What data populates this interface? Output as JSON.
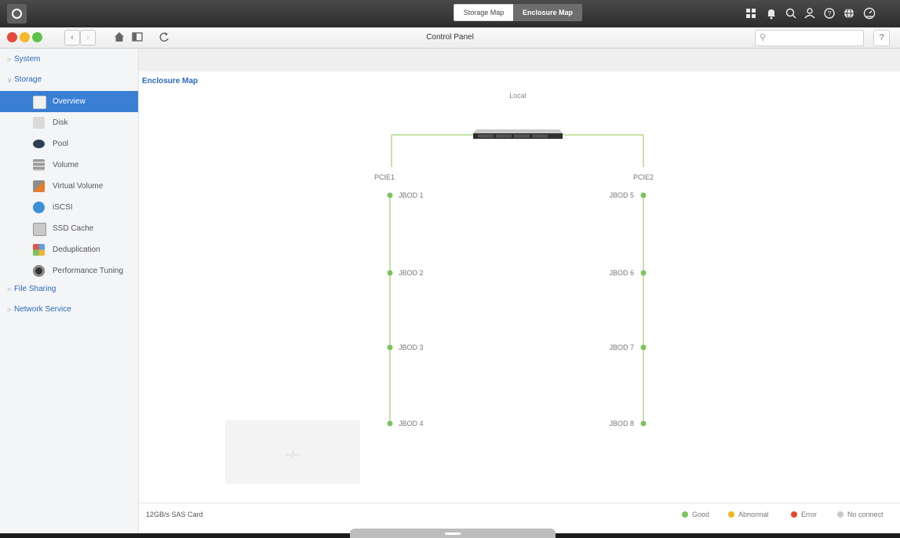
{
  "top_bar": {
    "icons": [
      "menu-grid-icon",
      "bell-icon",
      "search-icon",
      "user-icon",
      "help-circle-icon",
      "globe-icon",
      "dashboard-icon"
    ]
  },
  "toolbar": {
    "title": "Control Panel",
    "search_placeholder": "",
    "help_label": "?"
  },
  "sidebar": {
    "sections": [
      {
        "label": "System"
      },
      {
        "label": "Storage"
      },
      {
        "label": "File Sharing"
      },
      {
        "label": "Network Service"
      }
    ],
    "storage_items": [
      {
        "label": "Overview",
        "icon": "overview-icon",
        "active": true
      },
      {
        "label": "Disk",
        "icon": "disk-icon"
      },
      {
        "label": "Pool",
        "icon": "pool-icon"
      },
      {
        "label": "Volume",
        "icon": "volume-icon"
      },
      {
        "label": "Virtual Volume",
        "icon": "virtual-volume-icon"
      },
      {
        "label": "iSCSI",
        "icon": "iscsi-icon"
      },
      {
        "label": "SSD Cache",
        "icon": "ssd-cache-icon"
      },
      {
        "label": "Deduplication",
        "icon": "deduplication-icon"
      },
      {
        "label": "Performance Tuning",
        "icon": "performance-tuning-icon"
      }
    ]
  },
  "main": {
    "tabs": [
      {
        "label": "Storage Map",
        "selected": false
      },
      {
        "label": "Enclosure Map",
        "selected": true
      }
    ],
    "heading": "Enclosure Map",
    "map": {
      "root_label": "Local",
      "ports": [
        "PCIE1",
        "PCIE2"
      ],
      "left_jbods": [
        "JBOD 1",
        "JBOD 2",
        "JBOD 3",
        "JBOD 4"
      ],
      "right_jbods": [
        "JBOD 5",
        "JBOD 6",
        "JBOD 7",
        "JBOD 8"
      ],
      "placeholder": "--/--"
    },
    "footer": {
      "card": "12GB/s SAS Card",
      "legend": [
        {
          "label": "Good",
          "color": "#7cc35c"
        },
        {
          "label": "Abnormal",
          "color": "#f3b51b"
        },
        {
          "label": "Error",
          "color": "#e8462c"
        },
        {
          "label": "No connect",
          "color": "#c8c8c8"
        }
      ]
    }
  },
  "colors": {
    "accent": "#2a6ab8",
    "active_item": "#3a7fd4",
    "link_line": "#b4d98a",
    "status_good": "#7cc35c"
  }
}
